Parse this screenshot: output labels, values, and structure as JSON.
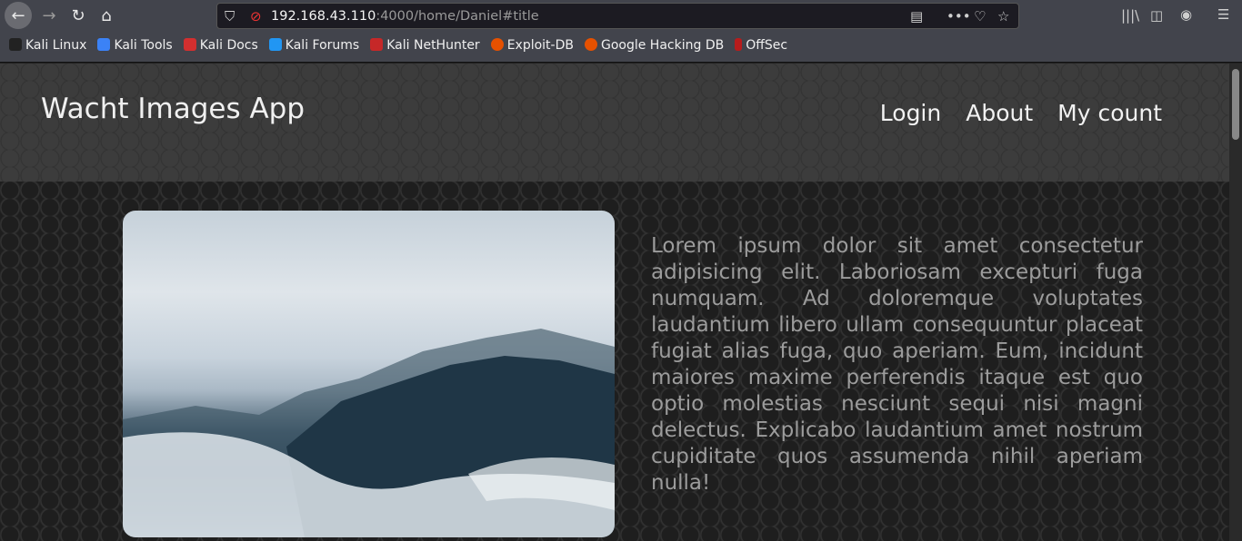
{
  "browser": {
    "url_host": "192.168.43.110",
    "url_path": ":4000/home/Daniel#title",
    "bookmarks": [
      "Kali Linux",
      "Kali Tools",
      "Kali Docs",
      "Kali Forums",
      "Kali NetHunter",
      "Exploit-DB",
      "Google Hacking DB",
      "OffSec"
    ],
    "bookmark_colors": [
      "#222222",
      "#3b82f6",
      "#d32f2f",
      "#2196f3",
      "#c62828",
      "#e65100",
      "#e65100",
      "#b71c1c"
    ]
  },
  "app": {
    "title": "Wacht Images App",
    "nav": [
      "Login",
      "About",
      "My count"
    ],
    "body_text": "Lorem ipsum dolor sit amet consectetur adipisicing elit. Laboriosam excepturi fuga numquam. Ad doloremque voluptates laudantium libero ullam consequuntur placeat fugiat alias fuga, quo aperiam. Eum, incidunt maiores maxime perferendis itaque est quo optio molestias nesciunt sequi nisi magni delectus. Explicabo laudantium amet nostrum cupiditate quos assumenda nihil aperiam nulla!"
  }
}
